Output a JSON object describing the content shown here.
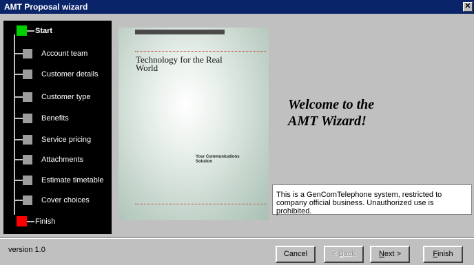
{
  "window": {
    "title": "AMT Proposal  wizard",
    "close_glyph": "✕"
  },
  "steps": [
    {
      "label": "Start",
      "status": "start"
    },
    {
      "label": "Account team",
      "status": "pending"
    },
    {
      "label": "Customer details",
      "status": "pending"
    },
    {
      "label": "Customer type",
      "status": "pending"
    },
    {
      "label": "Benefits",
      "status": "pending"
    },
    {
      "label": "Service pricing",
      "status": "pending"
    },
    {
      "label": "Attachments",
      "status": "pending"
    },
    {
      "label": "Estimate timetable",
      "status": "pending"
    },
    {
      "label": "Cover choices",
      "status": "pending"
    },
    {
      "label": "Finish",
      "status": "finish"
    }
  ],
  "cover": {
    "title": "Technology for the Real World",
    "tagline": "Your Communications Solution"
  },
  "welcome": {
    "line1": "Welcome to the",
    "line2": "AMT Wizard!"
  },
  "notice": "This is a GenComTelephone system, restricted to company official business.  Unauthorized use is prohibited.",
  "footer": {
    "version": "version 1.0"
  },
  "buttons": {
    "cancel": "Cancel",
    "back": {
      "mnemonic": "<",
      "accel": "B",
      "rest": "ack"
    },
    "next": {
      "accel": "N",
      "rest": "ext >"
    },
    "finish": {
      "accel": "F",
      "rest": "inish"
    }
  },
  "colors": {
    "titlebar": "#0a246a",
    "start": "#00d000",
    "finish": "#ff0000",
    "pending": "#9c9c9c"
  }
}
